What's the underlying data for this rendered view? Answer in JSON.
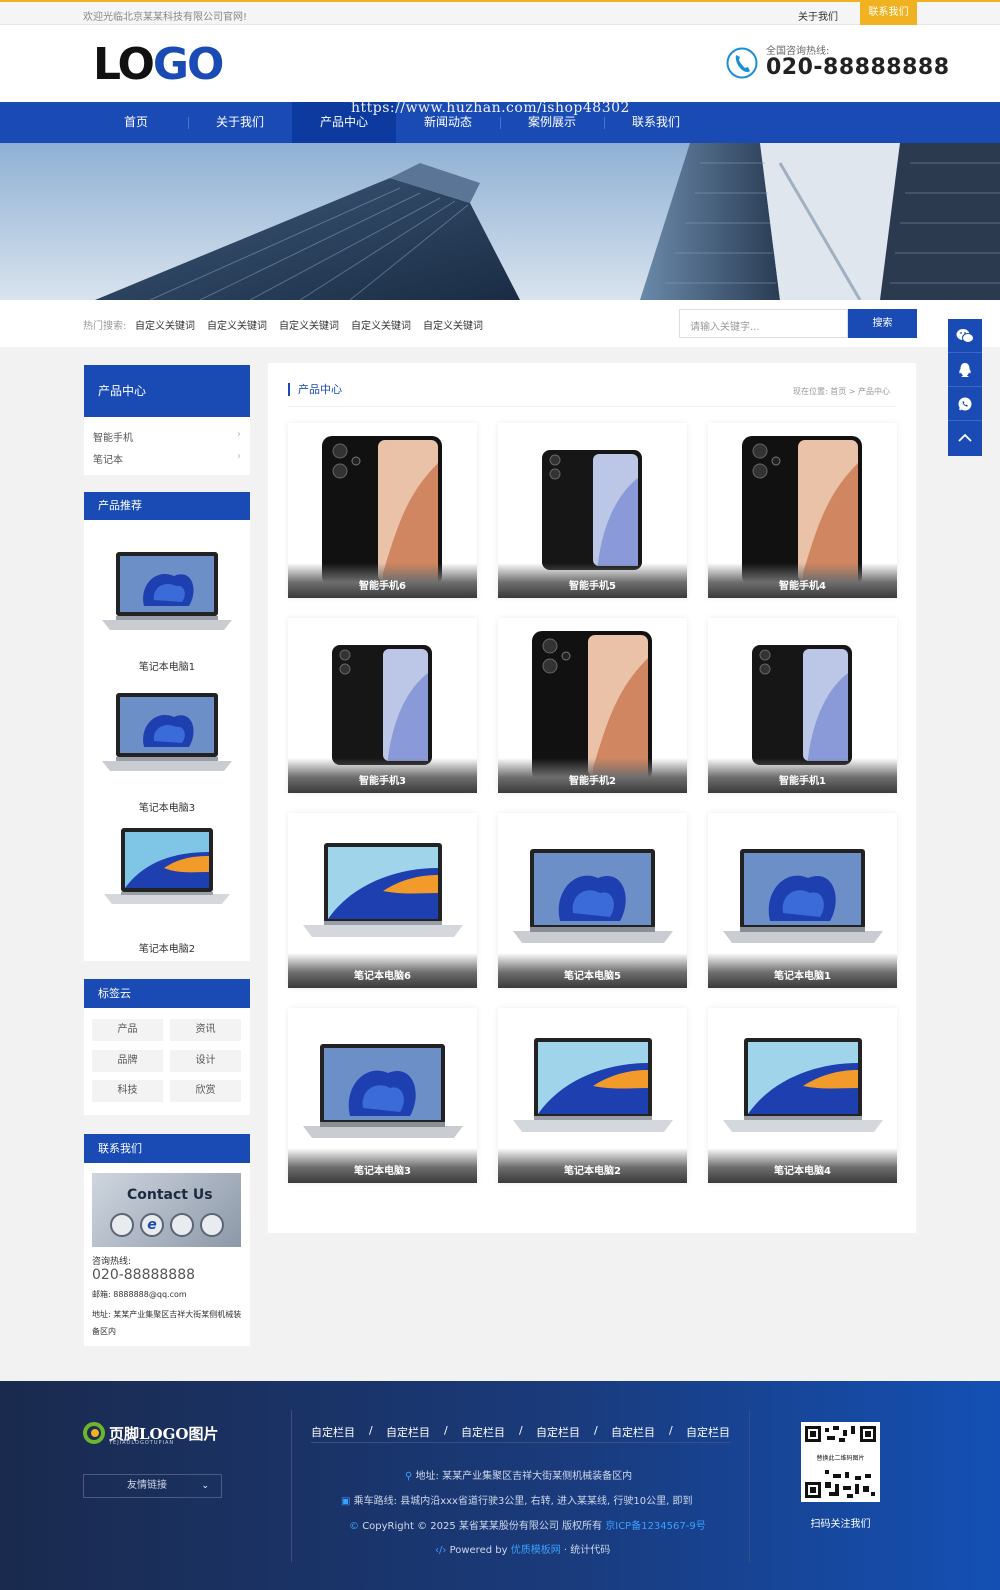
{
  "topbar": {
    "welcome": "欢迎光临北京某某科技有限公司官网!",
    "about": "关于我们",
    "contact": "联系我们"
  },
  "header": {
    "logo_left": "LO",
    "logo_right": "GO",
    "hotline_label": "全国咨询热线:",
    "hotline": "020-88888888"
  },
  "nav": {
    "items": [
      "首页",
      "关于我们",
      "产品中心",
      "新闻动态",
      "案例展示",
      "联系我们"
    ],
    "active": "产品中心",
    "watermark": "https://www.huzhan.com/ishop48302"
  },
  "search": {
    "hot_label": "热门搜索:",
    "keywords": [
      "自定义关键词",
      "自定义关键词",
      "自定义关键词",
      "自定义关键词",
      "自定义关键词"
    ],
    "placeholder": "请输入关键字...",
    "button": "搜索"
  },
  "sidebar": {
    "category_title": "产品中心",
    "categories": [
      "智能手机",
      "笔记本"
    ],
    "recommend_title": "产品推荐",
    "recommend": [
      "笔记本电脑1",
      "笔记本电脑3",
      "笔记本电脑2"
    ],
    "tags_title": "标签云",
    "tags": [
      "产品",
      "资讯",
      "品牌",
      "设计",
      "科技",
      "欣赏"
    ],
    "contact_title": "联系我们",
    "contact_image_text": "Contact Us",
    "contact_hotline_label": "咨询热线:",
    "contact_hotline": "020-88888888",
    "contact_email": "邮箱: 8888888@qq.com",
    "contact_address": "地址: 某某产业集聚区吉祥大街某侧机械装备区内"
  },
  "main": {
    "title": "产品中心",
    "breadcrumb": "现在位置: 首页 > 产品中心",
    "products": [
      "智能手机6",
      "智能手机5",
      "智能手机4",
      "智能手机3",
      "智能手机2",
      "智能手机1",
      "笔记本电脑6",
      "笔记本电脑5",
      "笔记本电脑1",
      "笔记本电脑3",
      "笔记本电脑2",
      "笔记本电脑4"
    ]
  },
  "footer": {
    "logo": "页脚LOGO图片",
    "logo_sub": "YEJIAOLOGOTUPIAN",
    "friend_links": "友情链接",
    "nav": [
      "自定栏目",
      "自定栏目",
      "自定栏目",
      "自定栏目",
      "自定栏目",
      "自定栏目"
    ],
    "address": "地址: 某某产业集聚区吉祥大街某侧机械装备区内",
    "route": "乘车路线: 县城内沿xxx省道行驶3公里, 右转, 进入某某线, 行驶10公里, 即到",
    "copyright": "CopyRight © 2025 某省某某股份有限公司 版权所有",
    "icp": "京ICP备1234567-9号",
    "powered_prefix": "Powered by",
    "powered_link": "优质模板网",
    "stats": "· 统计代码",
    "qr_text": "替换此二维码图片",
    "qr_caption": "扫码关注我们"
  },
  "colors": {
    "primary": "#1a4bb5",
    "accent": "#f0b220"
  },
  "icons": [
    "phone-icon",
    "wechat-icon",
    "qq-icon",
    "whatsapp-icon",
    "back-to-top-icon",
    "chevron-down-icon",
    "location-icon",
    "bus-icon",
    "copyright-icon",
    "code-icon"
  ]
}
